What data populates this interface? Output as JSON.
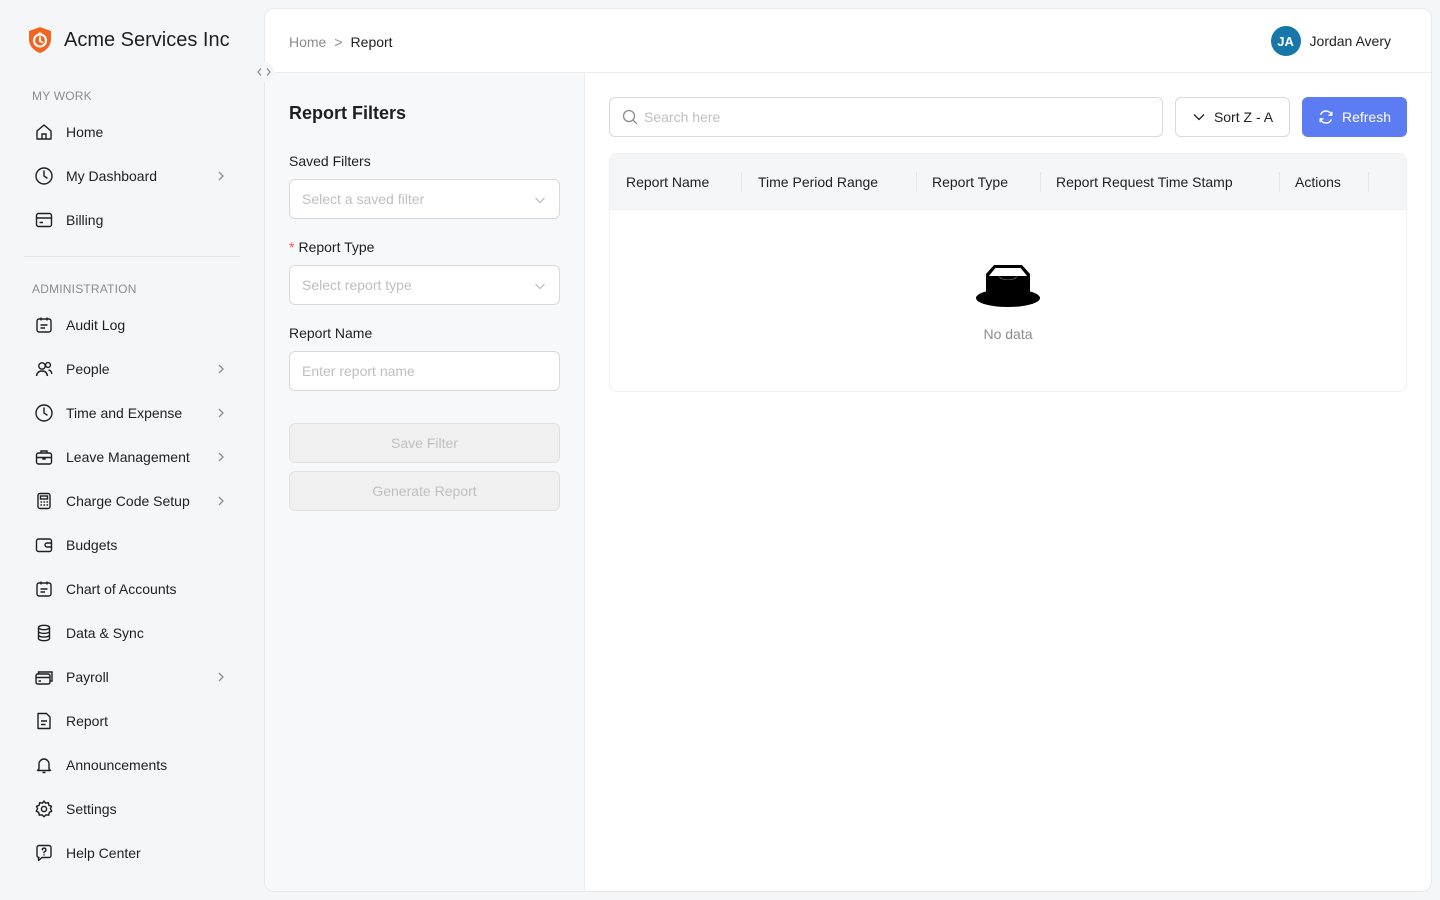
{
  "brand": {
    "name": "Acme Services Inc",
    "logo_icon": "shield-logo-icon",
    "accent": "#f26522"
  },
  "sidebar": {
    "sections": [
      {
        "label": "MY WORK"
      },
      {
        "label": "ADMINISTRATION"
      }
    ],
    "items": [
      {
        "label": "Home",
        "icon": "home-icon",
        "has_children": false
      },
      {
        "label": "My Dashboard",
        "icon": "clock-icon",
        "has_children": true
      },
      {
        "label": "Billing",
        "icon": "billing-icon",
        "has_children": false
      },
      {
        "label": "Audit Log",
        "icon": "calendar-icon",
        "has_children": false
      },
      {
        "label": "People",
        "icon": "people-icon",
        "has_children": true
      },
      {
        "label": "Time and Expense",
        "icon": "clock-icon",
        "has_children": true
      },
      {
        "label": "Leave Management",
        "icon": "briefcase-icon",
        "has_children": true
      },
      {
        "label": "Charge Code Setup",
        "icon": "calculator-icon",
        "has_children": true
      },
      {
        "label": "Budgets",
        "icon": "wallet-icon",
        "has_children": false
      },
      {
        "label": "Chart of Accounts",
        "icon": "calendar-icon",
        "has_children": false
      },
      {
        "label": "Data & Sync",
        "icon": "database-icon",
        "has_children": false
      },
      {
        "label": "Payroll",
        "icon": "card-stack-icon",
        "has_children": true
      },
      {
        "label": "Report",
        "icon": "document-icon",
        "has_children": false
      },
      {
        "label": "Announcements",
        "icon": "bell-icon",
        "has_children": false
      },
      {
        "label": "Settings",
        "icon": "gear-icon",
        "has_children": false
      },
      {
        "label": "Help Center",
        "icon": "help-chat-icon",
        "has_children": false
      }
    ]
  },
  "header": {
    "breadcrumb": {
      "home": "Home",
      "separator": ">",
      "current": "Report"
    },
    "user": {
      "initials": "JA",
      "name": "Jordan Avery",
      "avatar_color": "#1677a8"
    }
  },
  "filters": {
    "title": "Report Filters",
    "saved_filters": {
      "label": "Saved Filters",
      "placeholder": "Select a saved filter"
    },
    "report_type": {
      "label": "Report Type",
      "required_mark": "*",
      "placeholder": "Select report type"
    },
    "report_name": {
      "label": "Report Name",
      "placeholder": "Enter report name"
    },
    "save_button": "Save Filter",
    "generate_button": "Generate Report"
  },
  "results": {
    "search_placeholder": "Search here",
    "sort_label": "Sort Z - A",
    "refresh_label": "Refresh",
    "refresh_color": "#5b7cf2",
    "columns": [
      "Report Name",
      "Time Period Range",
      "Report Type",
      "Report Request Time Stamp",
      "Actions"
    ],
    "empty_text": "No data"
  }
}
